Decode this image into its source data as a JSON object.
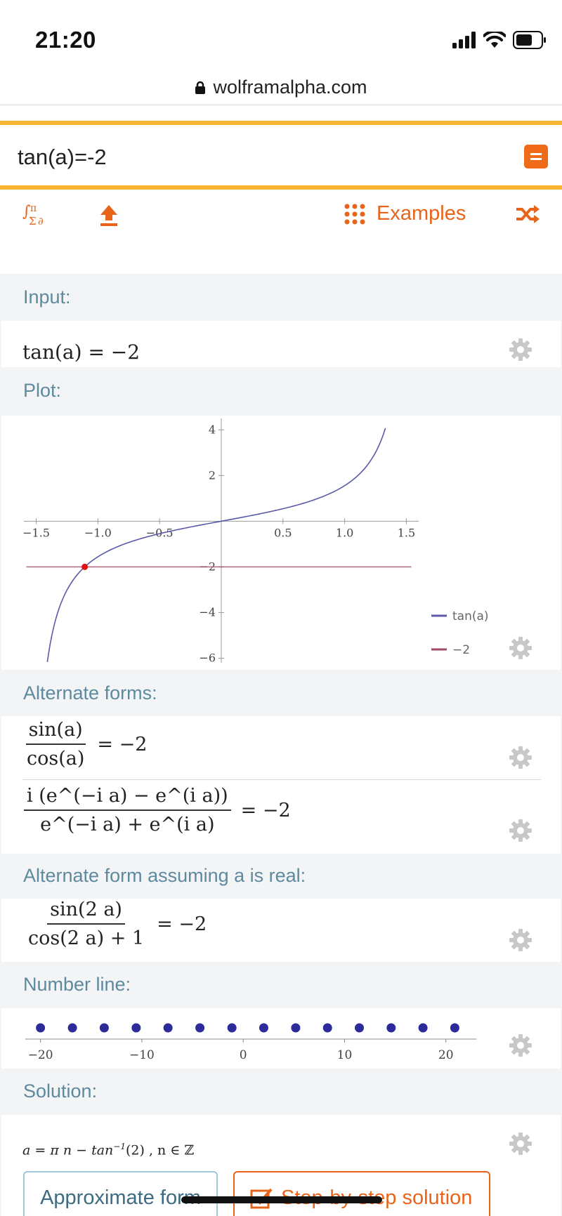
{
  "status_bar": {
    "time": "21:20"
  },
  "browser": {
    "url": "wolframalpha.com"
  },
  "search": {
    "query": "tan(a)=-2"
  },
  "toolbar": {
    "examples_label": "Examples"
  },
  "colors": {
    "accent": "#e8641a",
    "band": "#f8b531",
    "pod_title": "#5e8aa0",
    "curve": "#5a5aa8",
    "line": "#a04a6a",
    "point": "#e01010"
  },
  "pods": {
    "input": {
      "title": "Input:",
      "expr_lhs": "tan(a)",
      "expr_rhs": "= −2"
    },
    "plot": {
      "title": "Plot:"
    },
    "alternate_forms": {
      "title": "Alternate forms:",
      "form1_num": "sin(a)",
      "form1_den": "cos(a)",
      "form1_rhs": "= −2",
      "form2_num": "i (e^(−i a) − e^(i a))",
      "form2_den": "e^(−i a) + e^(i a)",
      "form2_rhs": "= −2"
    },
    "alternate_real": {
      "title": "Alternate form assuming a is real:",
      "num": "sin(2 a)",
      "den": "cos(2 a) + 1",
      "rhs": "= −2"
    },
    "number_line": {
      "title": "Number line:"
    },
    "solution": {
      "title": "Solution:",
      "expr": "a = π n − tan",
      "sup": "−1",
      "expr_tail": "(2) ,   n ∈ ℤ",
      "approx_button": "Approximate form",
      "step_button": "Step-by-step solution"
    }
  },
  "chart_data": [
    {
      "type": "line",
      "xlim": [
        -1.6,
        1.6
      ],
      "ylim": [
        -6.2,
        4.5
      ],
      "xticks": [
        -1.5,
        -1.0,
        -0.5,
        0.5,
        1.0,
        1.5
      ],
      "xtick_labels": [
        "−1.5",
        "−1.0",
        "−0.5",
        "0.5",
        "1.0",
        "1.5"
      ],
      "yticks": [
        4,
        2,
        -2,
        -4,
        -6
      ],
      "ytick_labels": [
        "4",
        "2",
        "−2",
        "−4",
        "−6"
      ],
      "series": [
        {
          "name": "tan(a)",
          "function": "tan",
          "x_range": [
            -1.41,
            1.33
          ]
        },
        {
          "name": "−2",
          "constant": -2,
          "x_range": [
            -1.58,
            1.54
          ]
        }
      ],
      "points": [
        {
          "x": -1.107,
          "y": -2
        }
      ],
      "legend": "right"
    },
    {
      "type": "scatter",
      "xlim": [
        -21.5,
        23
      ],
      "xticks": [
        -20,
        -10,
        0,
        10,
        20
      ],
      "xtick_labels": [
        "−20",
        "−10",
        "0",
        "10",
        "20"
      ],
      "values": [
        -20.0,
        -16.85,
        -13.71,
        -10.56,
        -7.42,
        -4.27,
        -1.11,
        2.03,
        5.18,
        8.32,
        11.46,
        14.6,
        17.74,
        20.88
      ]
    }
  ]
}
